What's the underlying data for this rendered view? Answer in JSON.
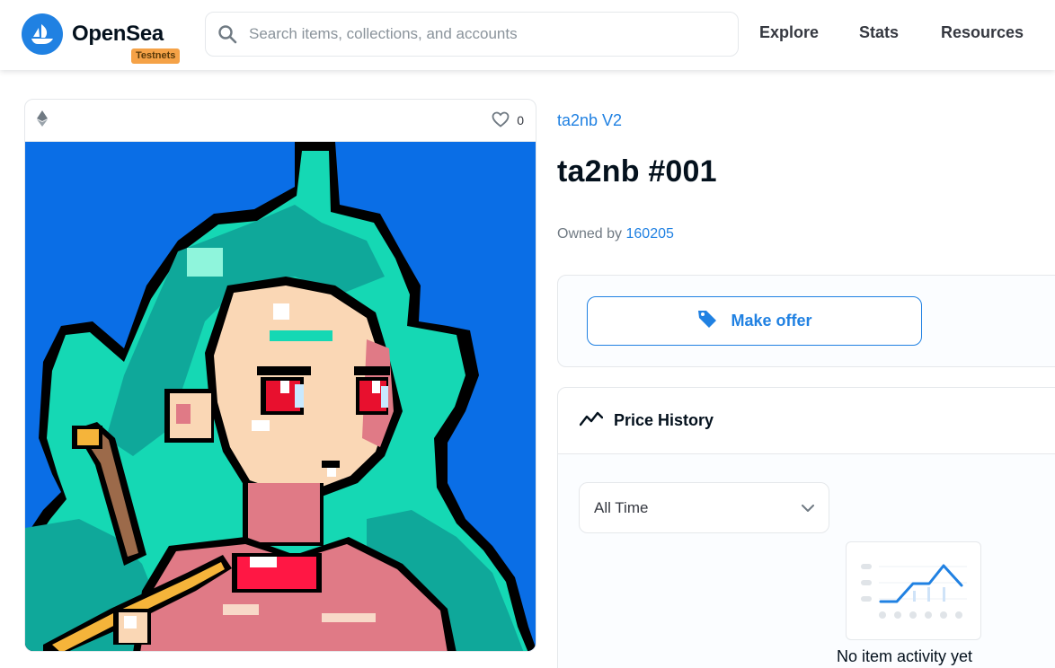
{
  "header": {
    "brand": "OpenSea",
    "badge": "Testnets",
    "search_placeholder": "Search items, collections, and accounts",
    "nav": [
      "Explore",
      "Stats",
      "Resources"
    ]
  },
  "item_card": {
    "chain_icon": "ethereum-icon",
    "favorite_icon": "heart-outline-icon",
    "favorites_count": "0",
    "image_alt": "Pixel art character with teal hair on blue background"
  },
  "item": {
    "collection": "ta2nb V2",
    "title": "ta2nb #001",
    "owned_by_label": "Owned by",
    "owner": "160205"
  },
  "offer": {
    "button_label": "Make offer",
    "icon": "price-tag-icon"
  },
  "price_history": {
    "title": "Price History",
    "icon": "trend-line-icon",
    "range_selected": "All Time",
    "empty_message": "No item activity yet"
  },
  "colors": {
    "accent": "#2081e2",
    "badge": "#f5a247",
    "art_background": "#0a6ee6",
    "hair": "#15d8b4"
  }
}
